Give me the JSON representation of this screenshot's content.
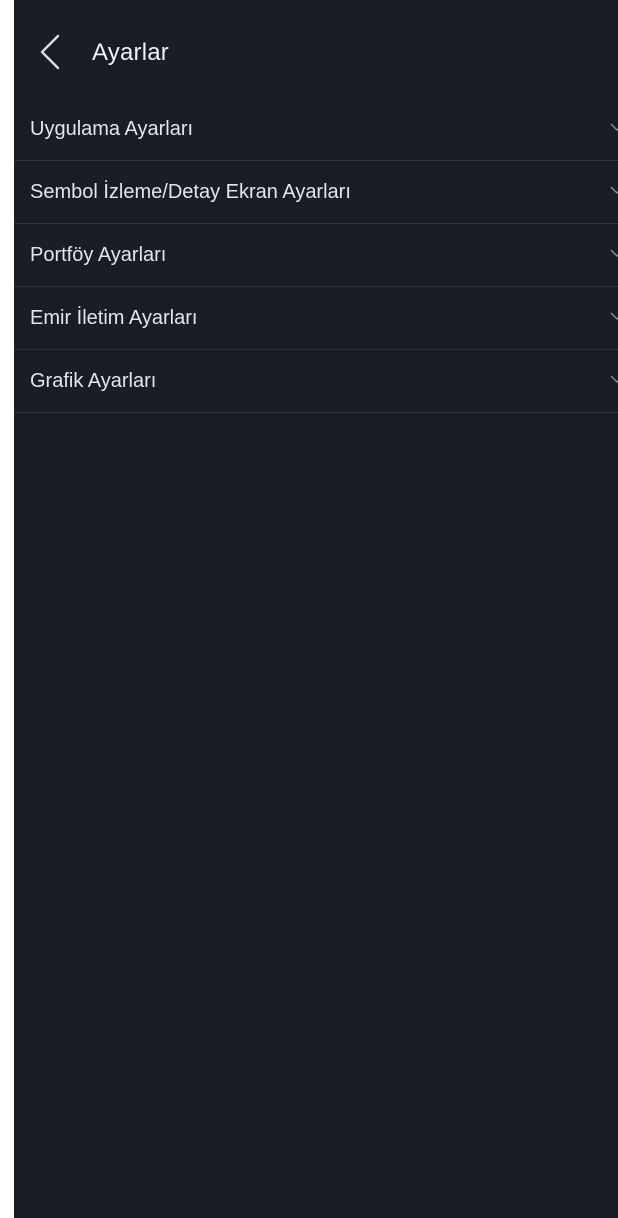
{
  "header": {
    "title": "Ayarlar",
    "back_icon": "chevron-left-icon"
  },
  "settings": {
    "items": [
      {
        "label": "Uygulama Ayarları",
        "icon": "chevron-down-icon"
      },
      {
        "label": "Sembol İzleme/Detay Ekran Ayarları",
        "icon": "chevron-down-icon"
      },
      {
        "label": "Portföy Ayarları",
        "icon": "chevron-down-icon"
      },
      {
        "label": "Emir İletim Ayarları",
        "icon": "chevron-down-icon"
      },
      {
        "label": "Grafik Ayarları",
        "icon": "chevron-down-icon"
      }
    ]
  },
  "colors": {
    "background": "#1a1d24",
    "text": "#e4e6ea",
    "divider": "#2e323b"
  }
}
